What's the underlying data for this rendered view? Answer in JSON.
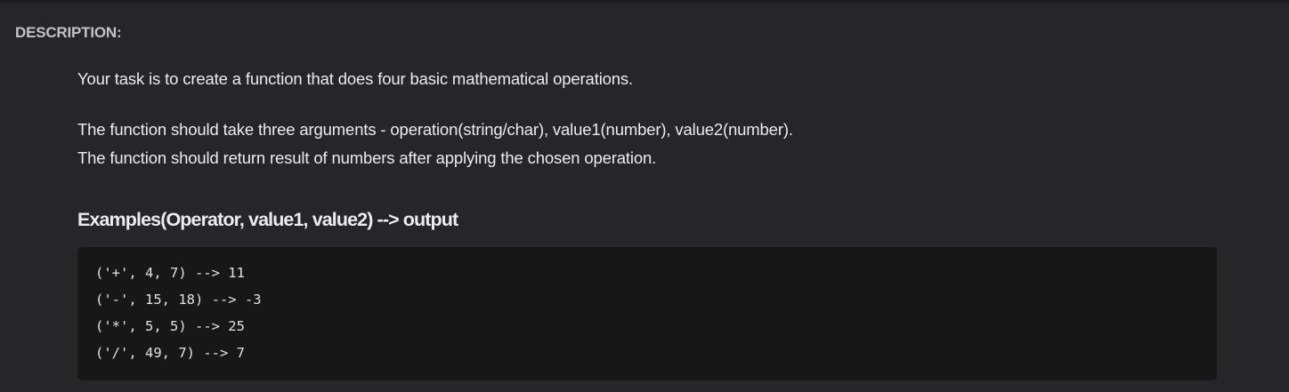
{
  "description": {
    "label": "DESCRIPTION:",
    "paragraphs": [
      "Your task is to create a function that does four basic mathematical operations.",
      "The function should take three arguments - operation(string/char), value1(number), value2(number).",
      "The function should return result of numbers after applying the chosen operation."
    ],
    "examples_heading": "Examples(Operator, value1, value2) --> output",
    "code_lines": [
      "('+', 4, 7) --> 11",
      "('-', 15, 18) --> -3",
      "('*', 5, 5) --> 25",
      "('/', 49, 7) --> 7"
    ]
  }
}
